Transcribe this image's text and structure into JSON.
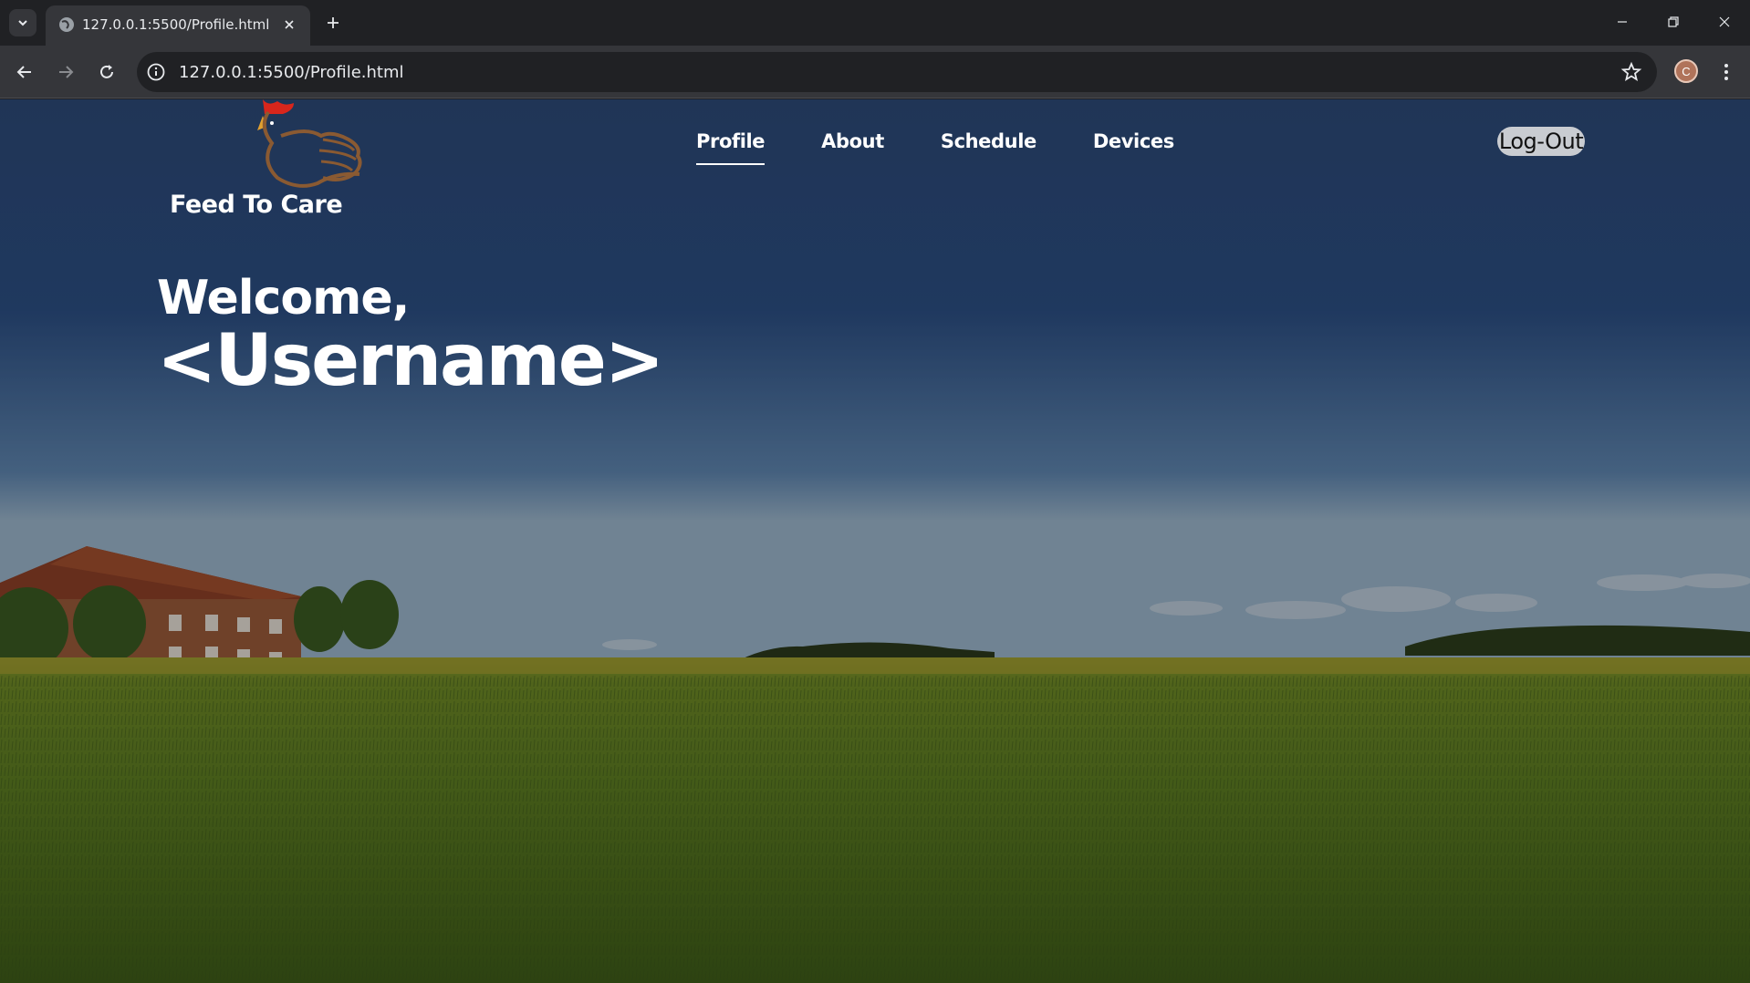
{
  "browser": {
    "tab_title": "127.0.0.1:5500/Profile.html",
    "url": "127.0.0.1:5500/Profile.html",
    "profile_initial": "C"
  },
  "site": {
    "brand": "Feed To Care",
    "nav": [
      {
        "label": "Profile",
        "active": true
      },
      {
        "label": "About",
        "active": false
      },
      {
        "label": "Schedule",
        "active": false
      },
      {
        "label": "Devices",
        "active": false
      }
    ],
    "logout_label": "Log-Out"
  },
  "hero": {
    "greeting": "Welcome,",
    "username": "<Username>"
  },
  "colors": {
    "sky_top": "#1f3558",
    "sky_horizon": "#6f8fb3",
    "field": "#4d6a1c",
    "barn_roof": "#a04a2a",
    "rooster_comb": "#d8261c"
  }
}
